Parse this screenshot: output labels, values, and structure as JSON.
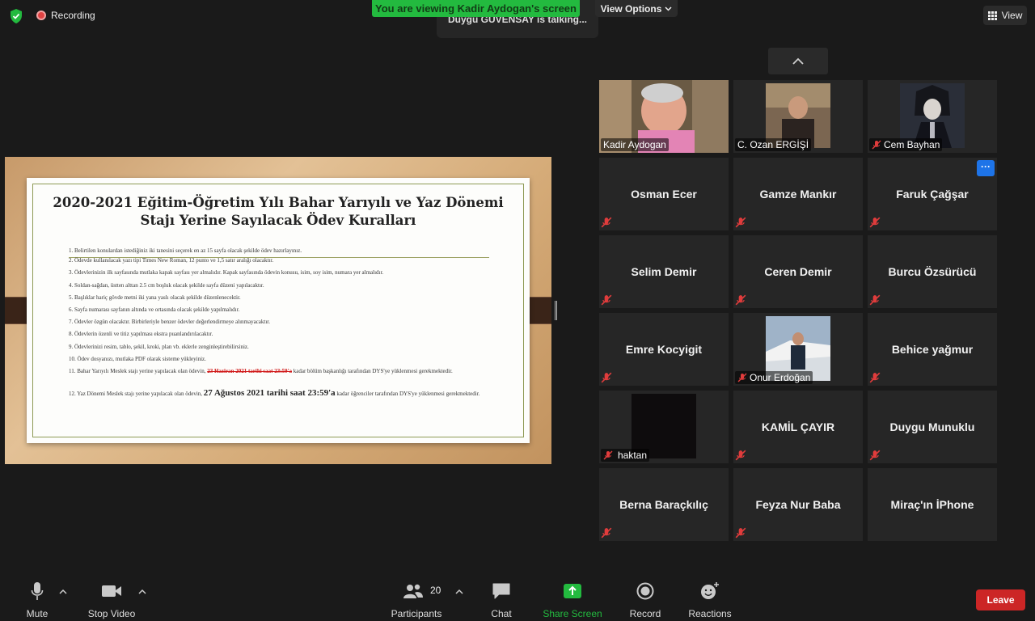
{
  "top": {
    "recording_label": "Recording",
    "viewing_banner": "You are viewing Kadir Aydogan's screen",
    "talking_label": "Duygu GÜVENSAY is talking...",
    "view_options_label": "View Options",
    "view_label": "View"
  },
  "document": {
    "title_line1": "2020-2021 Eğitim-Öğretim Yılı Bahar Yarıyılı ve Yaz Dönemi",
    "title_line2": "Stajı Yerine Sayılacak Ödev Kuralları",
    "rules": [
      "1. Belirtilen konulardan istediğiniz iki tanesini seçerek en az 15 sayfa olacak şekilde ödev hazırlayınız.",
      "2. Ödevde kullanılacak yazı tipi Times New Roman, 12 punto ve 1,5 satır aralığı olacaktır.",
      "3. Ödevlerinizin ilk sayfasında mutlaka kapak sayfası yer almalıdır. Kapak sayfasında ödevin konusu, isim, soy isim, numara yer almalıdır.",
      "4. Soldan-sağdan, üstten alttan 2.5 cm boşluk olacak şekilde sayfa düzeni yapılacaktır.",
      "5. Başlıklar hariç gövde metni iki yana yaslı olacak şekilde düzenlenecektir.",
      "6. Sayfa numarası sayfanın altında ve ortasında olacak şekilde yapılmalıdır.",
      "7. Ödevler özgün olacaktır. Birbirleriyle benzer ödevler değerlendirmeye alınmayacaktır.",
      "8. Ödevlerin özenli ve titiz yapılması ekstra puanlandırılacaktır.",
      "9. Ödevlerinizi resim, tablo, şekil, kroki, plan vb. eklerle zenginleştirebilirsiniz.",
      "10. Ödev dosyanızı, mutlaka PDF olarak sisteme yükleyiniz."
    ],
    "rule11_pre": "11. Bahar Yarıyılı Meslek stajı yerine yapılacak olan ödevin,",
    "rule11_strike": "23 Haziran 2021 tarihi saat 23:59'a",
    "rule11_post": "kadar bölüm başkanlığı tarafından DYS'ye yüklenmesi gerekmektedir.",
    "rule12_pre": "12. Yaz Dönemi Meslek stajı yerine yapılacak olan ödevin,",
    "rule12_deadline": "27 Ağustos 2021 tarihi saat 23:59'a",
    "rule12_post": "kadar öğrenciler tarafından DYS'ye yüklenmesi gerekmektedir."
  },
  "participants_tiles": [
    {
      "name": "Kadir Aydogan",
      "video": true
    },
    {
      "name": "C. Ozan ERGİŞİ",
      "video": true
    },
    {
      "name": "Cem Bayhan",
      "video": true
    },
    {
      "name": "Osman Ecer"
    },
    {
      "name": "Gamze Mankır"
    },
    {
      "name": "Faruk Çağşar"
    },
    {
      "name": "Selim Demir"
    },
    {
      "name": "Ceren Demir"
    },
    {
      "name": "Burcu Özsürücü"
    },
    {
      "name": "Emre Kocyigit"
    },
    {
      "name": "Onur Erdoğan",
      "video": true
    },
    {
      "name": "Behice yağmur"
    },
    {
      "name": "haktan",
      "video": true
    },
    {
      "name": "KAMİL ÇAYIR"
    },
    {
      "name": "Duygu Munuklu"
    },
    {
      "name": "Berna Baraçkılıç"
    },
    {
      "name": "Feyza Nur Baba"
    },
    {
      "name": "Miraç'ın İPhone"
    }
  ],
  "toolbar": {
    "mute": "Mute",
    "stop_video": "Stop Video",
    "participants": "Participants",
    "participants_count": "20",
    "chat": "Chat",
    "share_screen": "Share Screen",
    "record": "Record",
    "reactions": "Reactions",
    "leave": "Leave"
  },
  "colors": {
    "share_green": "#23ba3f",
    "leave_red": "#cc2626",
    "more_blue": "#1e74e8"
  },
  "more_button": "···"
}
